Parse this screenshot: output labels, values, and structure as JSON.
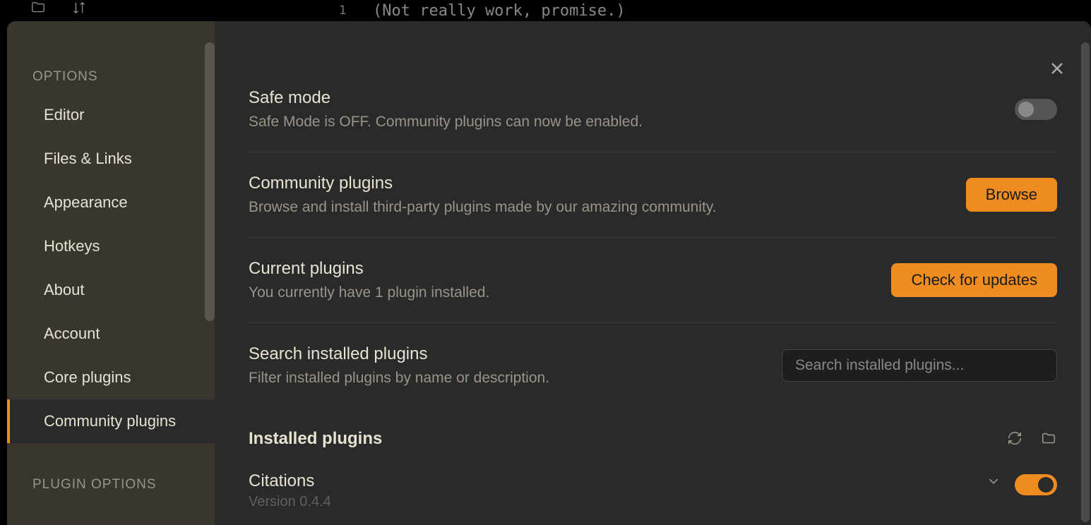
{
  "editor": {
    "line_num": "1",
    "text": "(Not really work, promise.)"
  },
  "sidebar": {
    "section_options": "OPTIONS",
    "section_plugin_options": "PLUGIN OPTIONS",
    "items": [
      {
        "label": "Editor"
      },
      {
        "label": "Files & Links"
      },
      {
        "label": "Appearance"
      },
      {
        "label": "Hotkeys"
      },
      {
        "label": "About"
      },
      {
        "label": "Account"
      },
      {
        "label": "Core plugins"
      },
      {
        "label": "Community plugins"
      }
    ]
  },
  "settings": {
    "safe_mode": {
      "title": "Safe mode",
      "desc": "Safe Mode is OFF. Community plugins can now be enabled."
    },
    "community": {
      "title": "Community plugins",
      "desc": "Browse and install third-party plugins made by our amazing community.",
      "button": "Browse"
    },
    "current": {
      "title": "Current plugins",
      "desc": "You currently have 1 plugin installed.",
      "button": "Check for updates"
    },
    "search": {
      "title": "Search installed plugins",
      "desc": "Filter installed plugins by name or description.",
      "placeholder": "Search installed plugins..."
    },
    "installed": {
      "header": "Installed plugins",
      "plugin_name": "Citations",
      "plugin_version": "Version 0.4.4"
    }
  }
}
